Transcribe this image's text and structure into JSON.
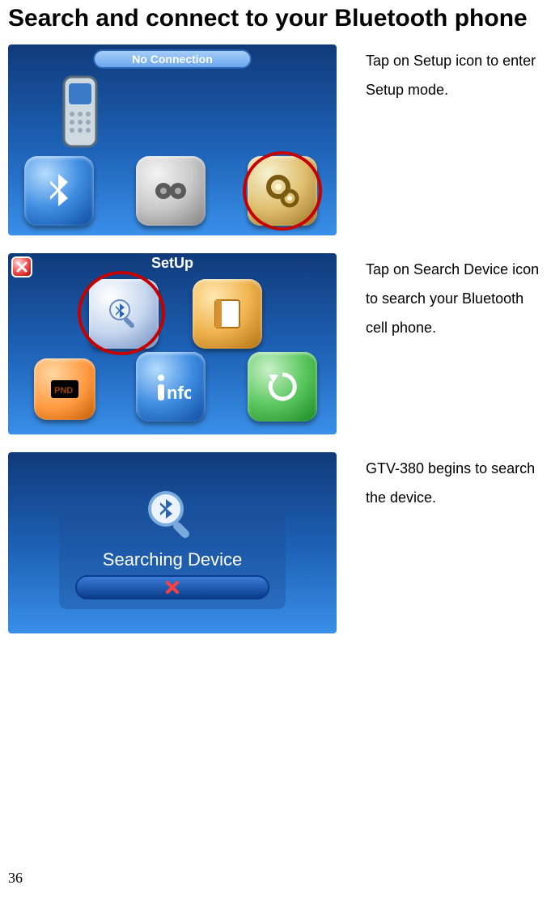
{
  "title": "Search and connect to your Bluetooth phone",
  "page_number": "36",
  "steps": [
    {
      "screenshot_title": "No Connection",
      "caption": "Tap on Setup icon to enter Setup mode."
    },
    {
      "screenshot_title": "SetUp",
      "caption": "Tap on Search Device icon to search your Bluetooth cell phone."
    },
    {
      "dialog_title": "Searching Device",
      "caption": "GTV-380 begins to search the device."
    }
  ]
}
